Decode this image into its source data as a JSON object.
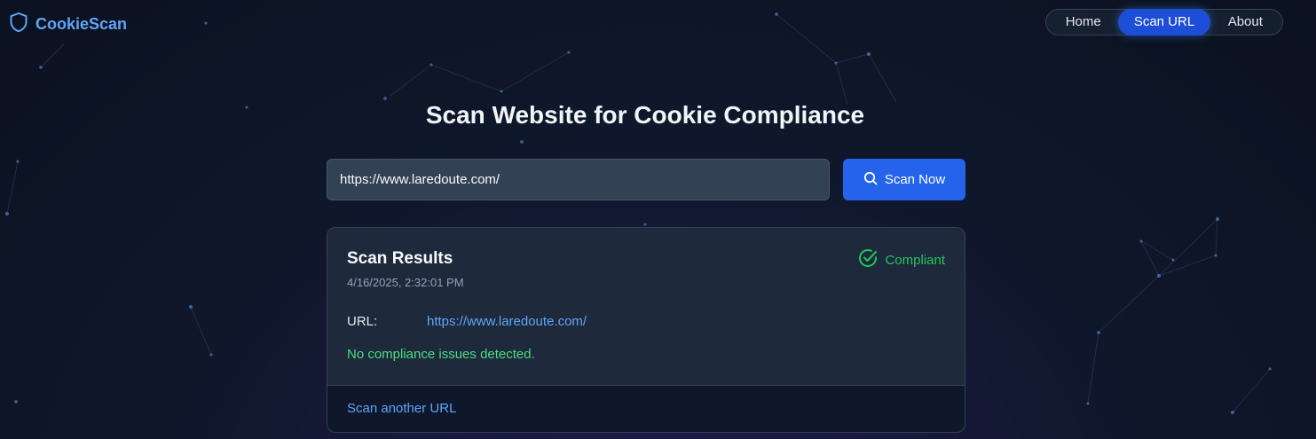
{
  "brand": {
    "name": "CookieScan",
    "icon": "shield-icon"
  },
  "nav": {
    "items": [
      {
        "label": "Home"
      },
      {
        "label": "Scan URL",
        "active": true
      },
      {
        "label": "About"
      }
    ]
  },
  "page": {
    "title": "Scan Website for Cookie Compliance"
  },
  "scan_form": {
    "url_value": "https://www.laredoute.com/",
    "button_label": "Scan Now",
    "button_icon": "search-icon"
  },
  "results": {
    "title": "Scan Results",
    "timestamp": "4/16/2025, 2:32:01 PM",
    "status_label": "Compliant",
    "status_icon": "check-circle-icon",
    "url_label": "URL:",
    "url_value": "https://www.laredoute.com/",
    "message": "No compliance issues detected.",
    "footer_link": "Scan another URL"
  },
  "colors": {
    "accent": "#2563eb",
    "brand": "#60a5fa",
    "success": "#22c55e",
    "background": "#0f172a",
    "card": "#1e293b"
  }
}
